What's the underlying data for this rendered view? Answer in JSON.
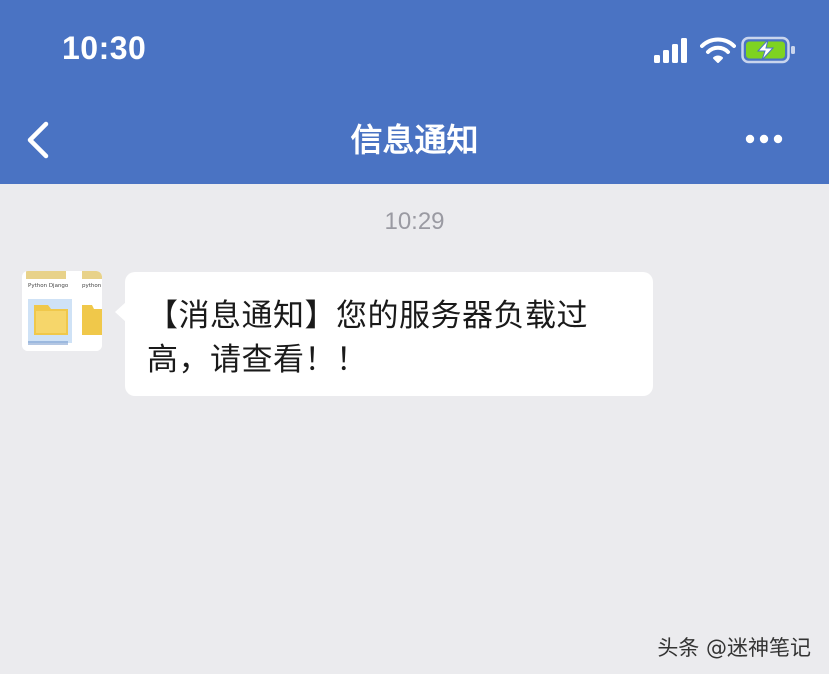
{
  "status_bar": {
    "time": "10:30"
  },
  "nav": {
    "title": "信息通知"
  },
  "chat": {
    "timestamp": "10:29",
    "message": "【消息通知】您的服务器负载过高，请查看！！",
    "avatar_texts": [
      "Python Django",
      "python"
    ]
  },
  "watermark": "头条 @迷神笔记",
  "colors": {
    "header_bg": "#4a73c3",
    "chat_bg": "#ebebee",
    "bubble_bg": "#ffffff",
    "battery_fill": "#7ed321"
  },
  "icons": [
    "signal-icon",
    "wifi-icon",
    "battery-charging-icon",
    "back-chevron-icon",
    "more-dots-icon"
  ]
}
